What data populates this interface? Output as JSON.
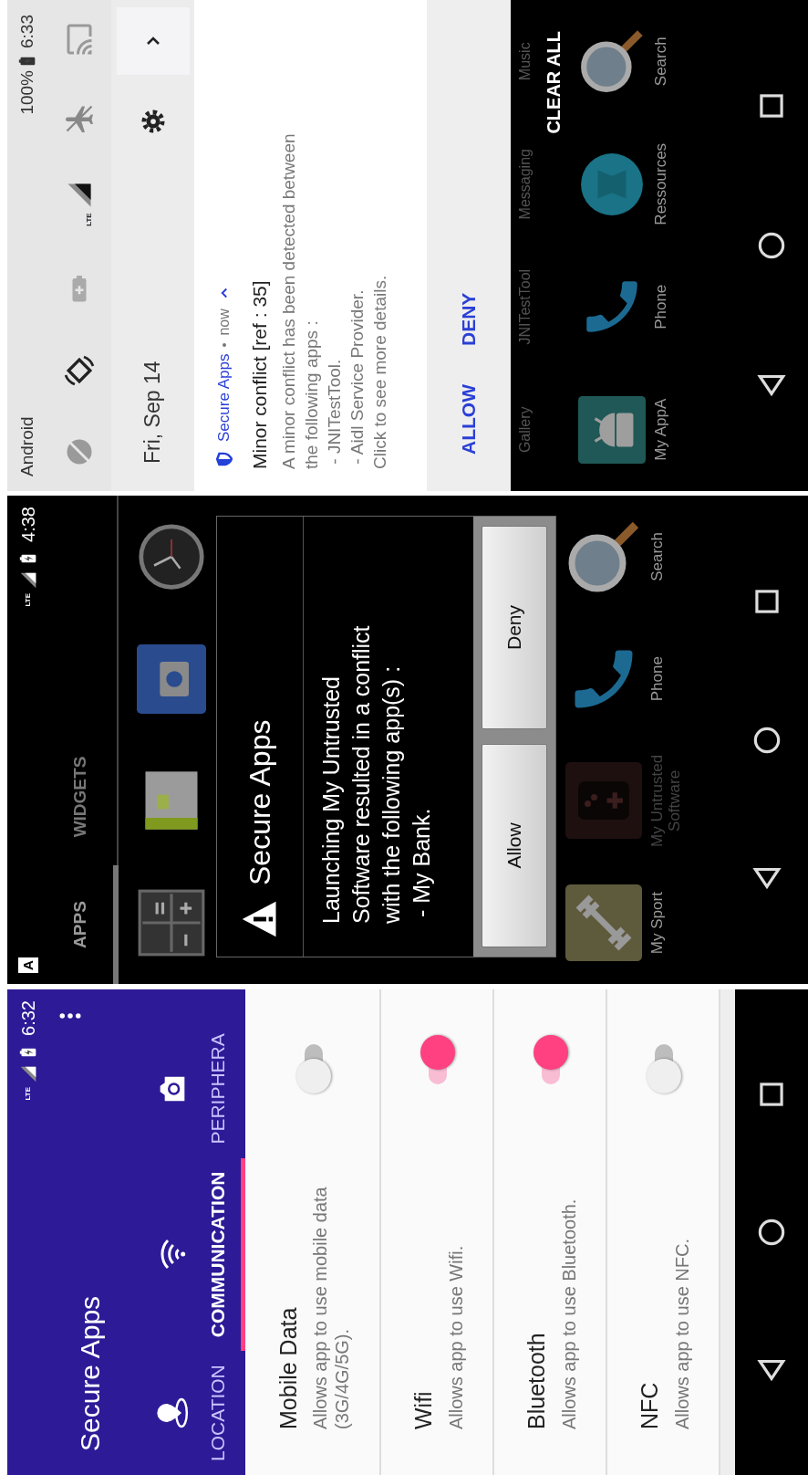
{
  "screens": [
    {
      "kind": "shade",
      "status": {
        "carrier": "Android",
        "battery": "100%",
        "time": "6:33"
      },
      "quick_settings": {
        "network": "LTE",
        "date": "Fri, Sep 14"
      },
      "notification": {
        "app": "Secure Apps",
        "time": "now",
        "expanded": true,
        "title": "Minor conflict [ref : 35]",
        "lines": [
          "A minor conflict has been detected between",
          "the following apps :",
          " - JNITestTool.",
          " - Aidl Service Provider.",
          "Click to see more details."
        ],
        "actions": [
          "ALLOW",
          "DENY"
        ]
      },
      "recents": {
        "labels": [
          "Gallery",
          "JNITestTool",
          "Messaging",
          "Music"
        ],
        "clear_all": "CLEAR ALL",
        "apps": [
          {
            "label": "My AppA",
            "kind": "android"
          },
          {
            "label": "Phone",
            "kind": "phone"
          },
          {
            "label": "Ressources",
            "kind": "ressources"
          },
          {
            "label": "Search",
            "kind": "search"
          }
        ]
      }
    },
    {
      "kind": "dialog",
      "status": {
        "notification": "A",
        "network": "LTE",
        "time": "4:38"
      },
      "tabs": [
        {
          "label": "APPS",
          "selected": true
        },
        {
          "label": "WIDGETS",
          "selected": false
        }
      ],
      "grid": [
        {
          "kind": "calculator"
        },
        {
          "kind": "calendar"
        },
        {
          "kind": "camera"
        },
        {
          "kind": "clock"
        }
      ],
      "dialog": {
        "title": "Secure Apps",
        "lines": [
          "Launching My Untrusted",
          "Software resulted in a conflict",
          "with the following app(s) :",
          " - My Bank."
        ],
        "buttons": [
          "Allow",
          "Deny"
        ]
      },
      "dock": [
        {
          "label": "My Sport",
          "kind": "dumbbell",
          "dimmed": false
        },
        {
          "label": "My Untrusted Software",
          "kind": "gamepad",
          "dimmed": true
        },
        {
          "label": "Phone",
          "kind": "phone",
          "dimmed": false
        },
        {
          "label": "Search",
          "kind": "search",
          "dimmed": false
        }
      ]
    },
    {
      "kind": "settings",
      "status": {
        "network": "LTE",
        "time": "6:32"
      },
      "title": "Secure Apps",
      "tabs": [
        {
          "label": "LOCATION",
          "kind": "pin",
          "selected": false
        },
        {
          "label": "COMMUNICATION",
          "kind": "wifi",
          "selected": true
        },
        {
          "label": "PERIPHERA",
          "kind": "camera",
          "selected": false
        }
      ],
      "rows": [
        {
          "title": "Mobile Data",
          "subtitle": "Allows app to use mobile data (3G/4G/5G).",
          "on": false
        },
        {
          "title": "Wifi",
          "subtitle": "Allows app to use Wifi.",
          "on": true
        },
        {
          "title": "Bluetooth",
          "subtitle": "Allows app to use Bluetooth.",
          "on": true
        },
        {
          "title": "NFC",
          "subtitle": "Allows app to use NFC.",
          "on": false
        }
      ]
    }
  ]
}
